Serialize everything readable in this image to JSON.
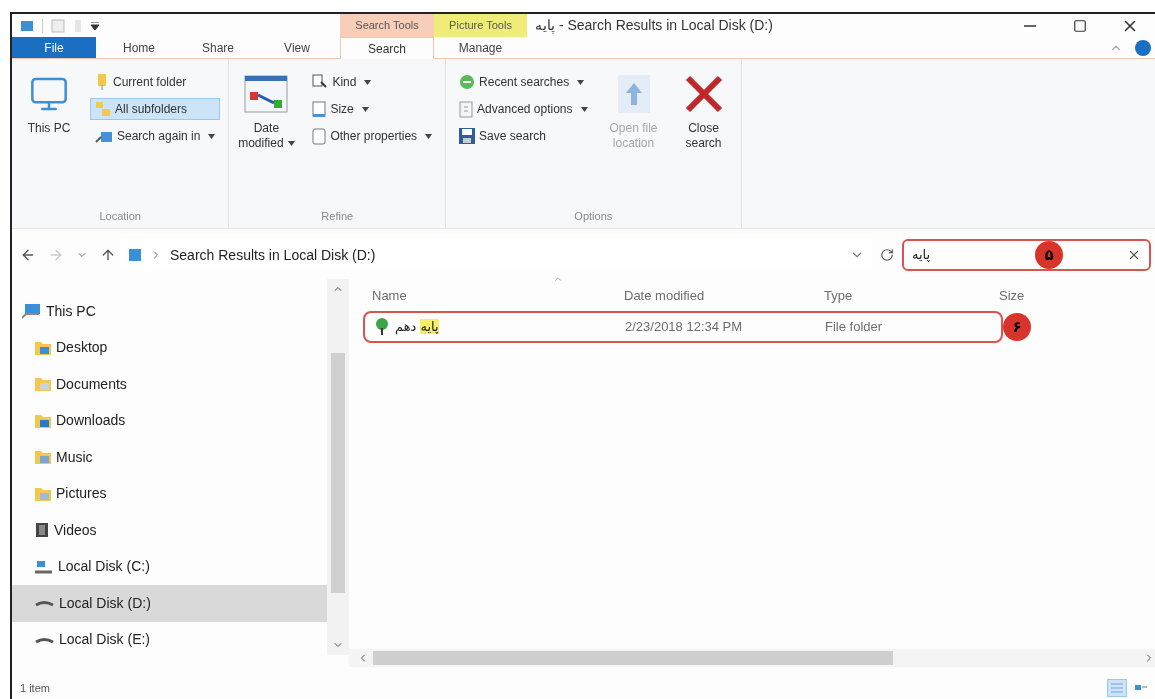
{
  "context_tabs": [
    {
      "label": "Search Tools",
      "color": "#f9ceb9"
    },
    {
      "label": "Picture Tools",
      "color": "#efed78"
    }
  ],
  "window": {
    "title": "پایه - Search Results in Local Disk (D:)"
  },
  "tabs": [
    {
      "label": "File",
      "kind": "file",
      "selected": false
    },
    {
      "label": "Home",
      "kind": "tab",
      "selected": false
    },
    {
      "label": "Share",
      "kind": "tab",
      "selected": false
    },
    {
      "label": "View",
      "kind": "tab",
      "selected": false
    },
    {
      "label": "Search",
      "kind": "tab",
      "selected": true
    },
    {
      "label": "Manage",
      "kind": "tab",
      "selected": false
    }
  ],
  "ribbon": {
    "groups": [
      {
        "label": "Location",
        "items": [
          {
            "kind": "large",
            "label": "This PC",
            "dropdown": false,
            "disabled": false
          },
          {
            "kind": "small",
            "label": "Current folder",
            "dropdown": false,
            "selected": false
          },
          {
            "kind": "small",
            "label": "All subfolders",
            "dropdown": false,
            "selected": true
          },
          {
            "kind": "small",
            "label": "Search again in",
            "dropdown": true,
            "selected": false
          }
        ]
      },
      {
        "label": "Refine",
        "items": [
          {
            "kind": "large",
            "label": "Date modified",
            "dropdown": true,
            "disabled": false
          },
          {
            "kind": "small",
            "label": "Kind",
            "dropdown": true,
            "selected": false
          },
          {
            "kind": "small",
            "label": "Size",
            "dropdown": true,
            "selected": false
          },
          {
            "kind": "small",
            "label": "Other properties",
            "dropdown": true,
            "selected": false
          }
        ]
      },
      {
        "label": "Options",
        "items": [
          {
            "kind": "small",
            "label": "Recent searches",
            "dropdown": true,
            "selected": false
          },
          {
            "kind": "small",
            "label": "Advanced options",
            "dropdown": true,
            "selected": false
          },
          {
            "kind": "small",
            "label": "Save search",
            "dropdown": false,
            "selected": false
          },
          {
            "kind": "large",
            "label": "Open file location",
            "dropdown": false,
            "disabled": true
          },
          {
            "kind": "large",
            "label": "Close search",
            "dropdown": false,
            "disabled": false
          }
        ]
      }
    ]
  },
  "navigation": {
    "back": {
      "disabled": false
    },
    "forward": {
      "disabled": true
    }
  },
  "address_bar": {
    "path": "Search Results in Local Disk (D:)"
  },
  "search": {
    "value": "پایه",
    "annotation": "۵"
  },
  "sidebar": {
    "items": [
      {
        "label": "This PC",
        "kind": "pc",
        "selected": false,
        "children": [
          {
            "label": "Desktop",
            "kind": "desktop",
            "selected": false
          },
          {
            "label": "Documents",
            "kind": "documents",
            "selected": false
          },
          {
            "label": "Downloads",
            "kind": "downloads",
            "selected": false
          },
          {
            "label": "Music",
            "kind": "music",
            "selected": false
          },
          {
            "label": "Pictures",
            "kind": "pictures",
            "selected": false
          },
          {
            "label": "Videos",
            "kind": "videos",
            "selected": false
          },
          {
            "label": "Local Disk (C:)",
            "kind": "system-drive",
            "selected": false
          },
          {
            "label": "Local Disk (D:)",
            "kind": "drive",
            "selected": true
          },
          {
            "label": "Local Disk (E:)",
            "kind": "drive",
            "selected": false
          }
        ]
      }
    ]
  },
  "table": {
    "columns": [
      {
        "label": "Name",
        "sorted": true
      },
      {
        "label": "Date modified",
        "sorted": false
      },
      {
        "label": "Type",
        "sorted": false
      },
      {
        "label": "Size",
        "sorted": false
      }
    ],
    "rows": [
      {
        "name": [
          {
            "text": "پایه",
            "match": true
          },
          {
            "text": "دهم",
            "match": false
          }
        ],
        "date_modified": "2/23/2018 12:34 PM",
        "type": "File folder",
        "annotation": "۶"
      }
    ]
  },
  "status_bar": {
    "text": "1 item"
  },
  "view_buttons": [
    {
      "kind": "details",
      "selected": true
    },
    {
      "kind": "large-icons",
      "selected": false
    }
  ]
}
